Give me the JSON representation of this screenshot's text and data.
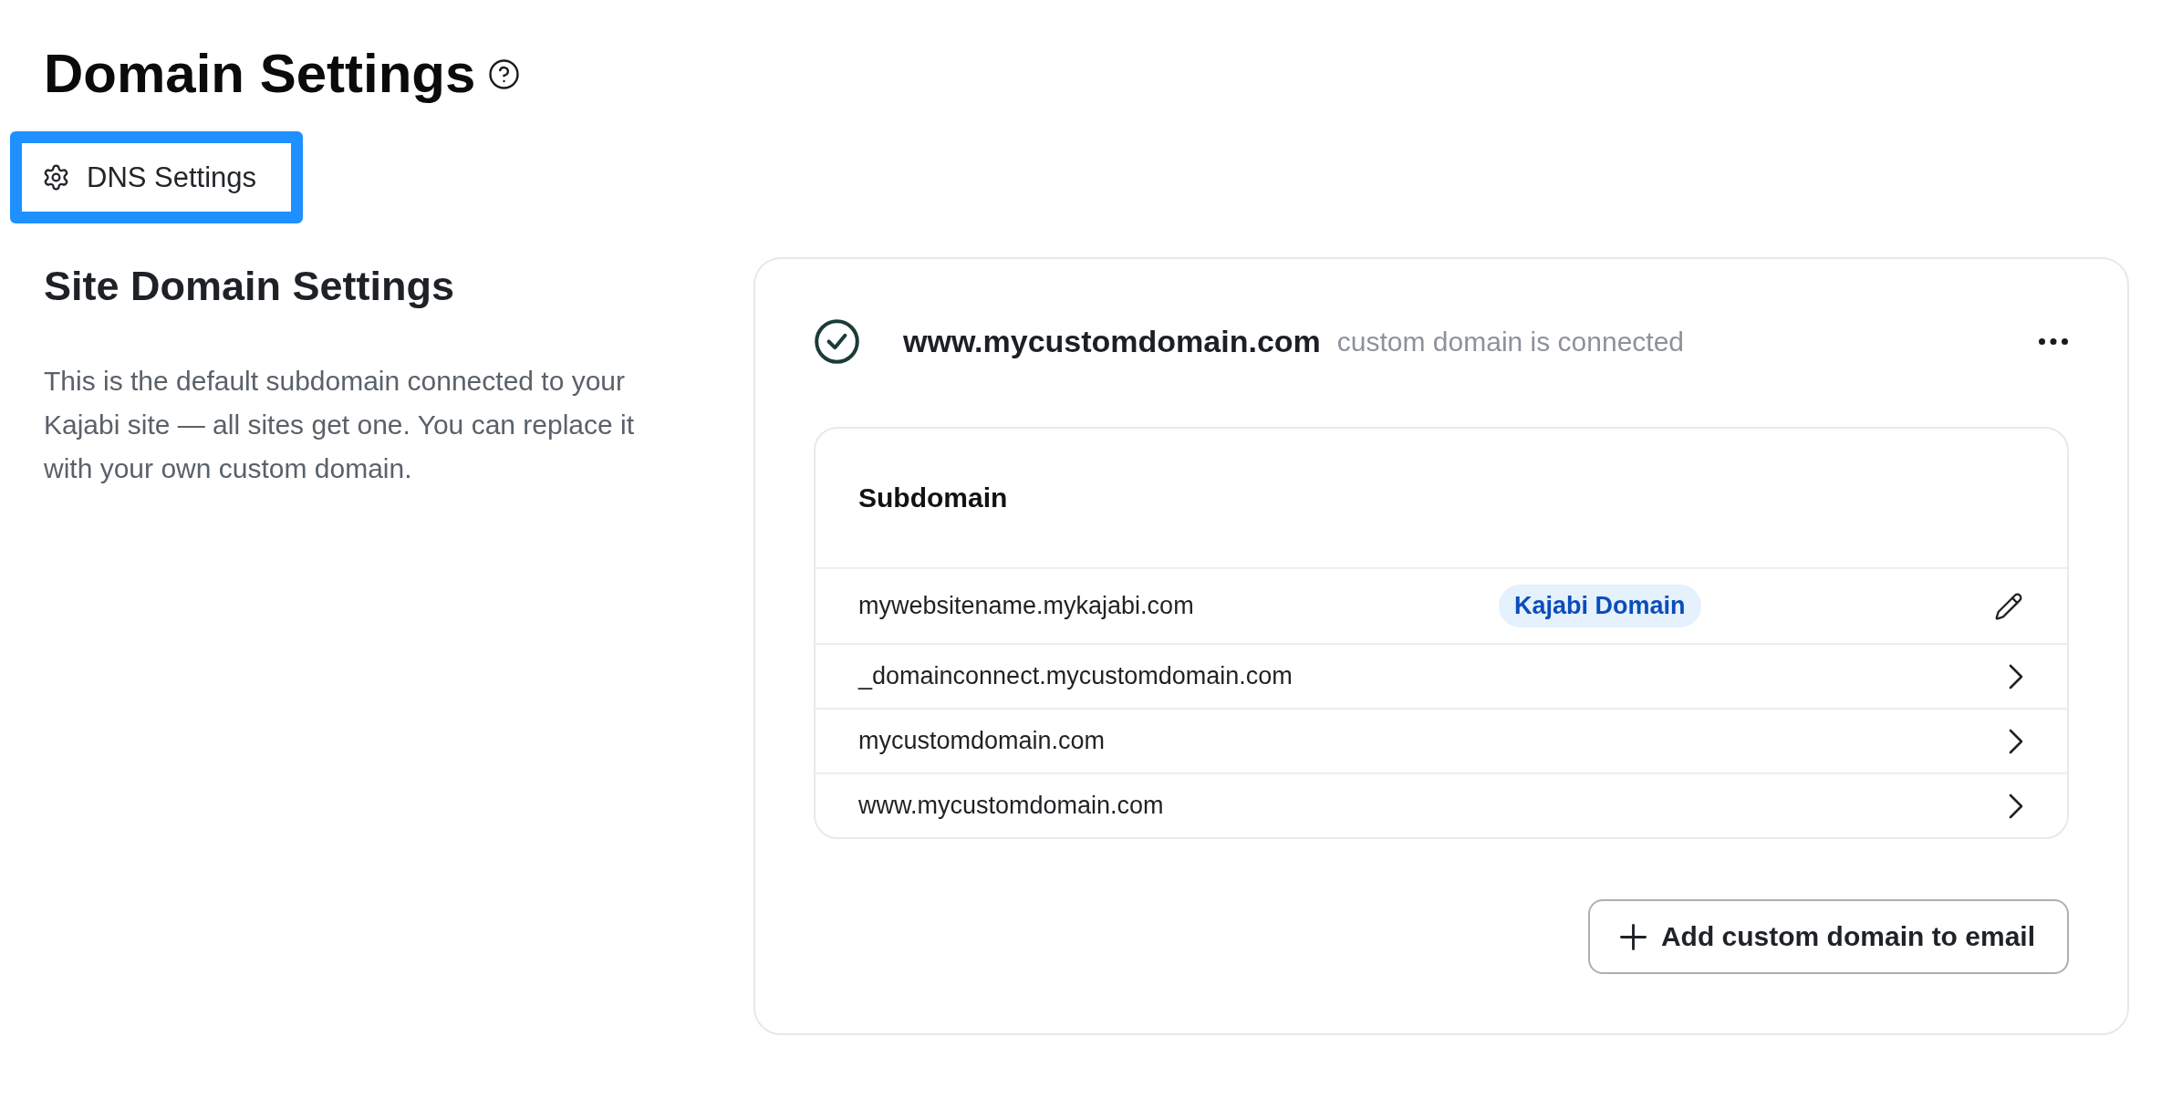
{
  "page": {
    "title": "Domain Settings"
  },
  "dns_button": {
    "label": "DNS Settings",
    "highlighted": true
  },
  "site_domain": {
    "heading": "Site Domain Settings",
    "description": "This is the default subdomain connected to your Kajabi site — all sites get one. You can replace it with your own custom domain."
  },
  "domain_card": {
    "domain": "www.mycustomdomain.com",
    "status": "custom domain is connected",
    "connected": true,
    "subdomain_table": {
      "heading": "Subdomain",
      "rows": [
        {
          "name": "mywebsitename.mykajabi.com",
          "badge": "Kajabi Domain",
          "kind": "edit"
        },
        {
          "name": "_domainconnect.mycustomdomain.com",
          "kind": "link"
        },
        {
          "name": "mycustomdomain.com",
          "kind": "link"
        },
        {
          "name": "www.mycustomdomain.com",
          "kind": "link"
        }
      ]
    },
    "add_button": {
      "label": "Add custom domain to email"
    }
  }
}
